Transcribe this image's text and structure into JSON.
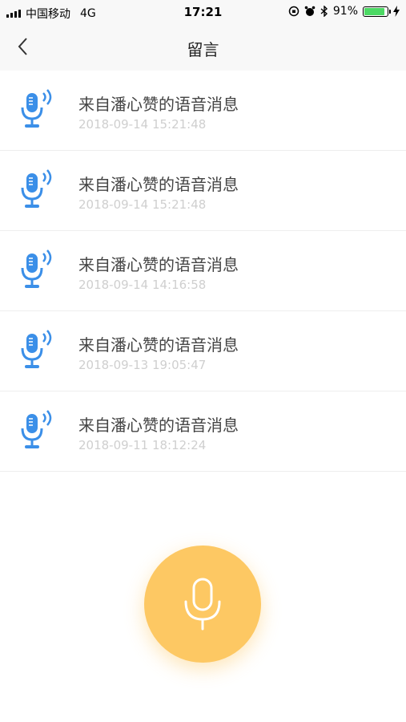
{
  "status": {
    "carrier": "中国移动",
    "network": "4G",
    "time": "17:21",
    "battery": "91%",
    "battery_level": 0.91
  },
  "nav": {
    "title": "留言",
    "back_icon": "chevron-left-icon"
  },
  "messages": [
    {
      "title": "来自潘心赞的语音消息",
      "time": "2018-09-14 15:21:48"
    },
    {
      "title": "来自潘心赞的语音消息",
      "time": "2018-09-14 15:21:48"
    },
    {
      "title": "来自潘心赞的语音消息",
      "time": "2018-09-14 14:16:58"
    },
    {
      "title": "来自潘心赞的语音消息",
      "time": "2018-09-13 19:05:47"
    },
    {
      "title": "来自潘心赞的语音消息",
      "time": "2018-09-11 18:12:24"
    }
  ],
  "colors": {
    "mic_icon": "#3b8fe8",
    "record_button": "#fdc863",
    "battery_fill": "#4cd964"
  },
  "record_button": {
    "icon": "microphone-icon"
  }
}
